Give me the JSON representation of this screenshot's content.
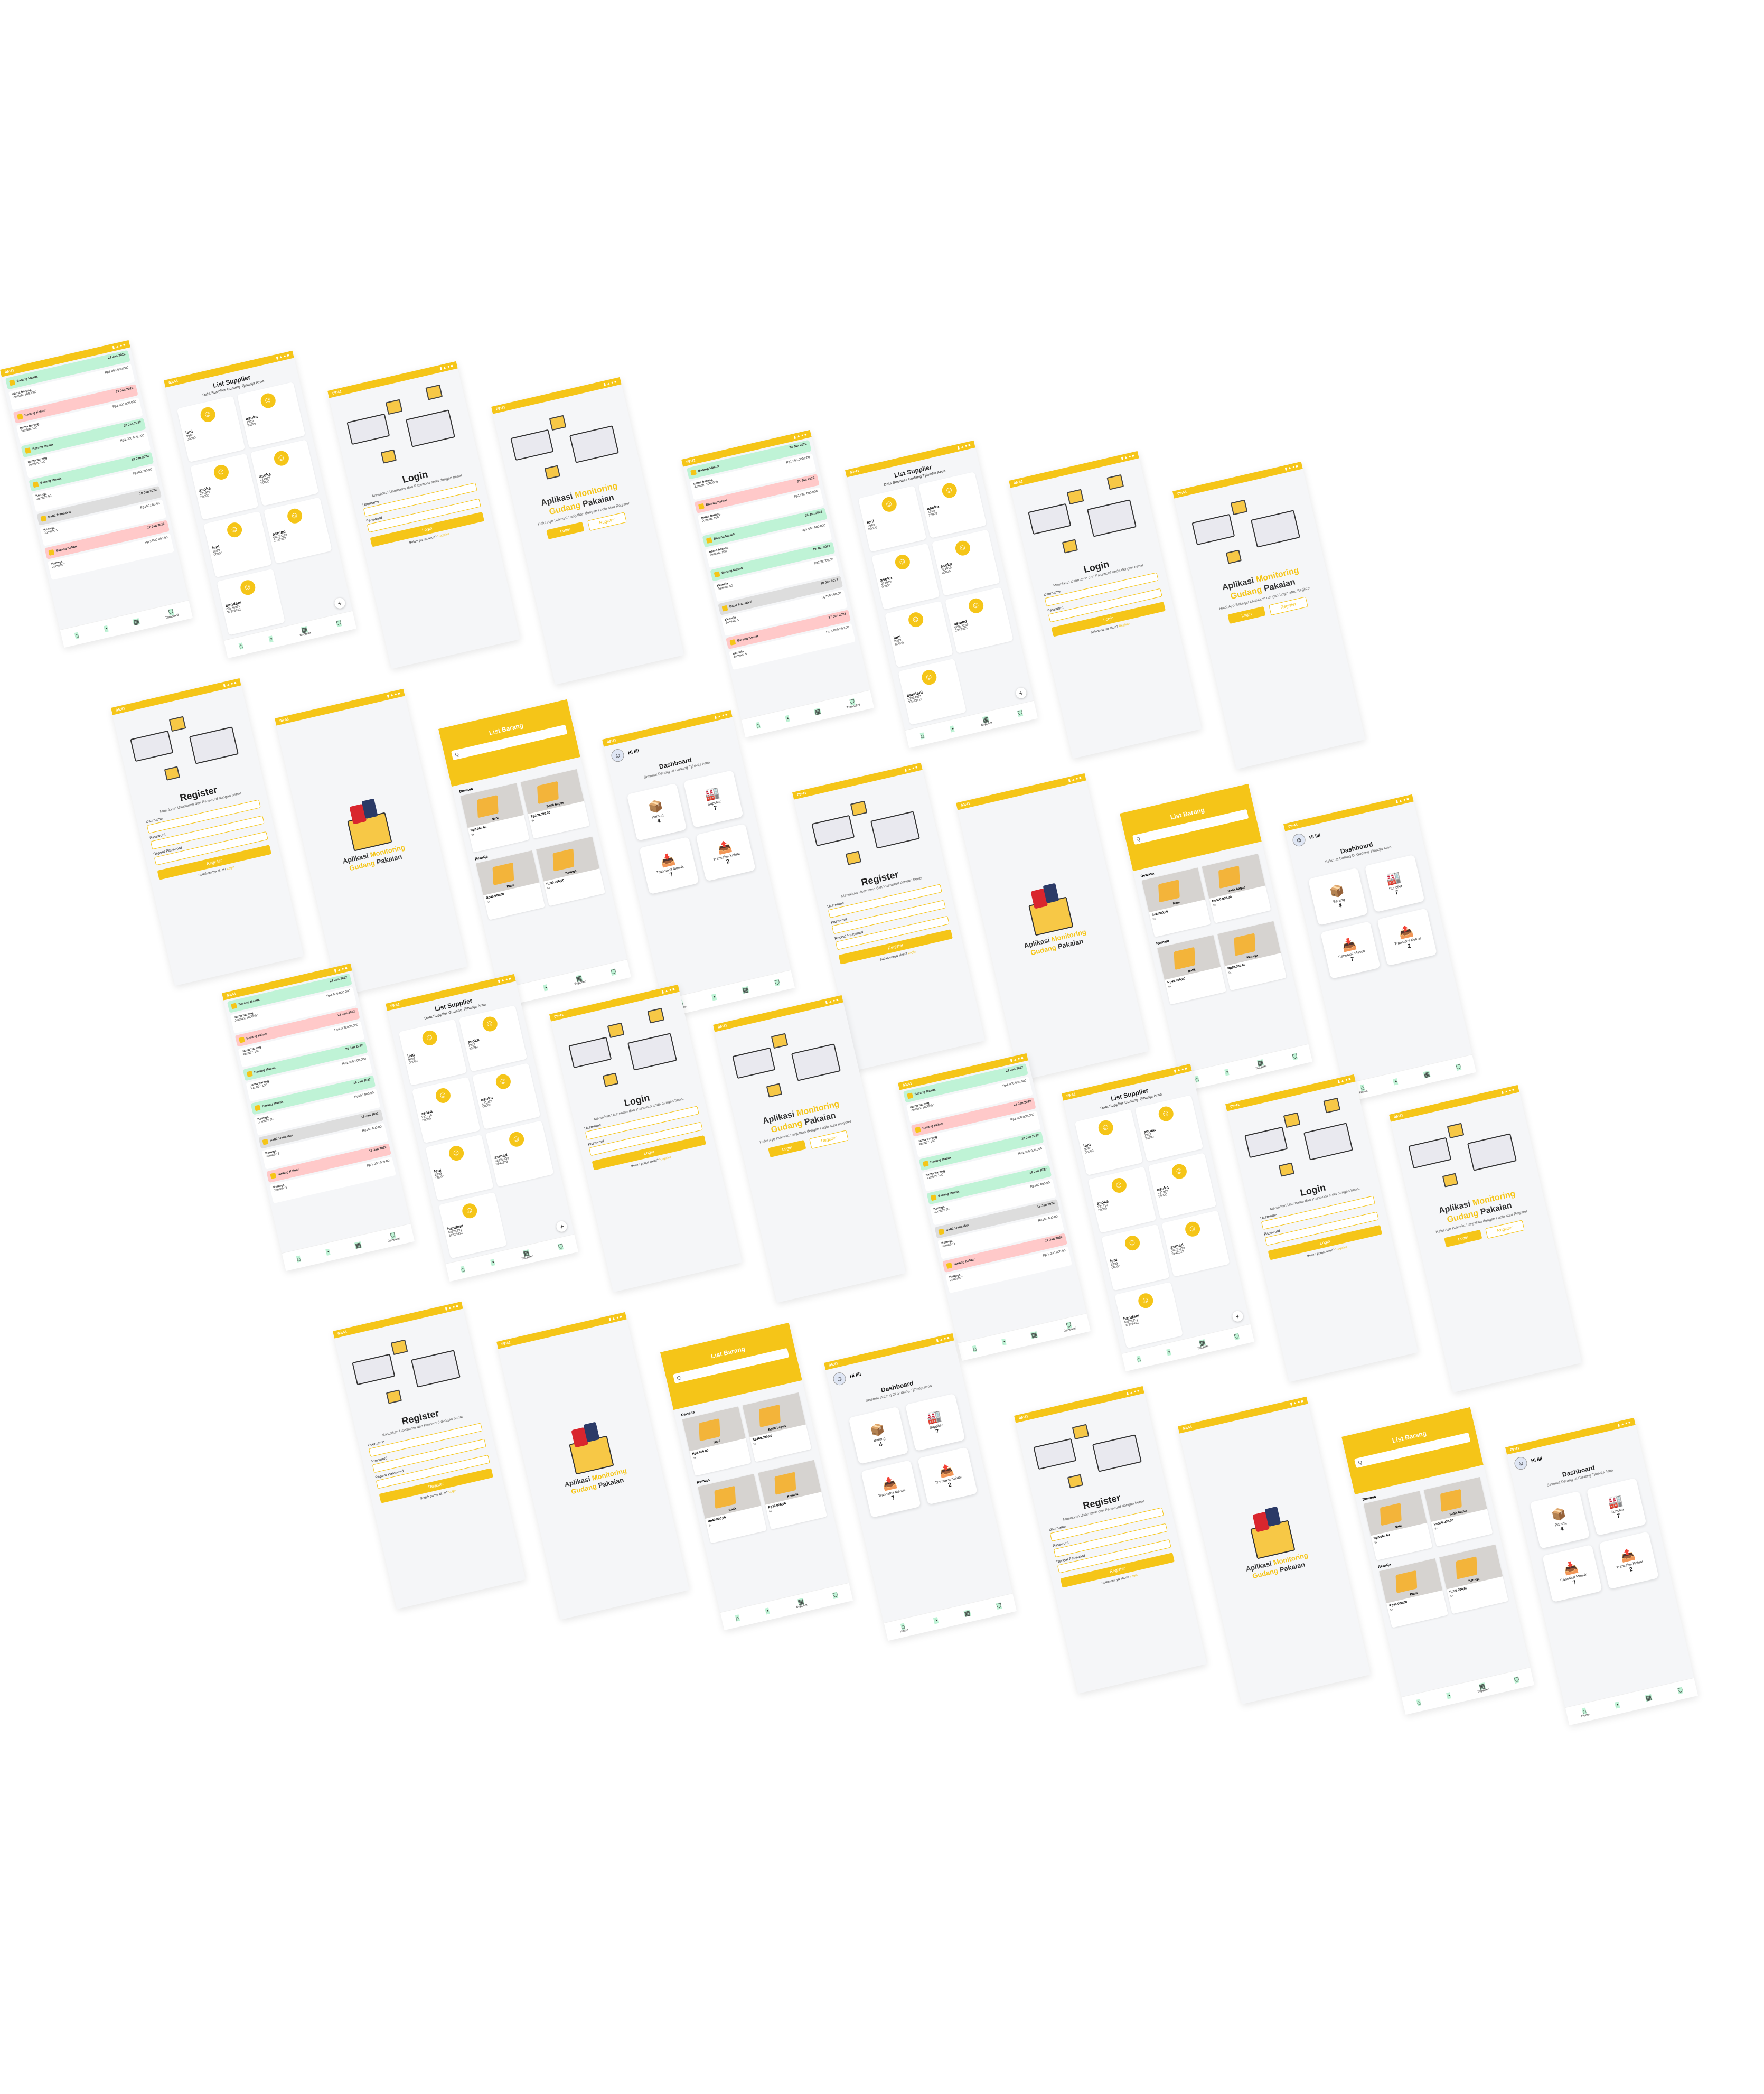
{
  "colors": {
    "accent": "#f5c518",
    "background": "#f5f6f8",
    "masuk": "#bff3d6",
    "keluar": "#ffc9c9",
    "batal": "#dddddd"
  },
  "status": {
    "time": "09:41",
    "icons": "▮ ▲ ● ■"
  },
  "nav": {
    "home": "Home",
    "dashboard": "Dashboard",
    "supplier": "Supplier",
    "transaksi": "Transaksi"
  },
  "login": {
    "title": "Login",
    "desc": "Masukkan Username dan Password anda dengan benar",
    "username_label": "Username",
    "password_label": "Password",
    "button": "Login",
    "link_text": "Belum punya akun?",
    "link_action": "Register"
  },
  "register": {
    "title": "Register",
    "desc": "Masukkan Username dan Password dengan benar",
    "username_label": "Username",
    "password_label": "Password",
    "repeat_label": "Repeat Password",
    "button": "Register",
    "link_text": "Sudah punya akun?",
    "link_action": "Login"
  },
  "welcome": {
    "title_a": "Aplikasi",
    "title_b": "Monitoring",
    "title_c": "Gudang",
    "title_d": "Pakaian",
    "desc": "Halo! Ayo Bekerja! Lanjutkan dengan Login atau Register",
    "login": "Login",
    "register": "Register"
  },
  "splash": {
    "title_a": "Aplikasi",
    "title_b": "Monitoring",
    "title_c": "Gudang",
    "title_d": "Pakaian"
  },
  "supplier": {
    "title": "List Supplier",
    "subtitle": "Data Supplier Gudang Tjihadja Aroa",
    "items": [
      {
        "name": "leni",
        "phone": "9999",
        "addr": "00000"
      },
      {
        "name": "asoka",
        "phone": "1919",
        "addr": "23999"
      },
      {
        "name": "asoka",
        "phone": "221919",
        "addr": "00000"
      },
      {
        "name": "asoka",
        "phone": "221919",
        "addr": "00000"
      },
      {
        "name": "leni",
        "phone": "8999",
        "addr": "00000"
      },
      {
        "name": "asmad",
        "phone": "08923233",
        "addr": "2342923"
      },
      {
        "name": "bandani",
        "phone": "02334991",
        "addr": "37323412"
      }
    ]
  },
  "dashboard": {
    "greeting": "Hi lili",
    "title": "Dashboard",
    "subtitle": "Selamat Datang Di Gudang Tjihadja Aroa",
    "cards": [
      {
        "label": "Barang",
        "value": "4",
        "icon": "📦"
      },
      {
        "label": "Supplier",
        "value": "7",
        "icon": "🏭"
      },
      {
        "label": "Transaksi Masuk",
        "value": "7",
        "icon": "📥"
      },
      {
        "label": "Transaksi Keluar",
        "value": "2",
        "icon": "📤"
      }
    ]
  },
  "barang": {
    "title": "List Barang",
    "search_placeholder": "Q",
    "categories": [
      {
        "name": "Dewasa",
        "items": [
          {
            "name": "Nani",
            "price": "Rp8.000,00",
            "qty": "5x"
          },
          {
            "name": "Batik bagus",
            "price": "Rp300.000,00",
            "qty": "5x"
          }
        ]
      },
      {
        "name": "Remaja",
        "items": [
          {
            "name": "Batik",
            "price": "Rp40.000,00",
            "qty": "5x"
          },
          {
            "name": "Kemeja",
            "price": "Rp30.000,00",
            "qty": "5x"
          }
        ]
      }
    ]
  },
  "transaksi": {
    "rows": [
      {
        "status": "Barang Masuk",
        "cls": "g",
        "name": "nama barang",
        "detail": "Jumlah: 1000000",
        "price": "Rp1.000.000.000",
        "date": "22 Jan 2022"
      },
      {
        "status": "Barang Keluar",
        "cls": "p",
        "name": "nama barang",
        "detail": "Jumlah: 100",
        "price": "Rp1.000.000.000",
        "date": "21 Jan 2022"
      },
      {
        "status": "Barang Masuk",
        "cls": "g",
        "name": "nama barang",
        "detail": "Jumlah: 100",
        "price": "Rp1.000.000.000",
        "date": "20 Jan 2022"
      },
      {
        "status": "Barang Masuk",
        "cls": "g",
        "name": "Kemeja",
        "detail": "Jumlah: 50",
        "price": "Rp100.000,00",
        "date": "19 Jan 2022"
      },
      {
        "status": "Batal Transaksi",
        "cls": "gy",
        "name": "Kemeja",
        "detail": "Jumlah: 5",
        "price": "Rp100.000,00",
        "date": "18 Jan 2022"
      },
      {
        "status": "Barang Keluar",
        "cls": "p",
        "name": "Kemeja",
        "detail": "Jumlah: 5",
        "price": "Rp 1.000.000,00",
        "date": "17 Jan 2022"
      }
    ]
  }
}
